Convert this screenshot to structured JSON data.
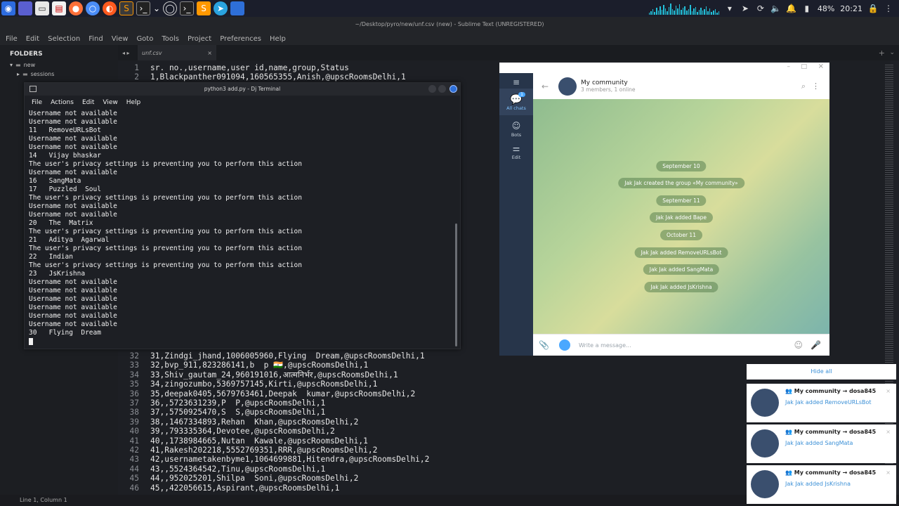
{
  "taskbar": {
    "apps": [
      "start-icon",
      "workspace-icon",
      "files-icon",
      "document-icon",
      "firefox-icon",
      "chromium-icon",
      "browser-icon",
      "sublime-icon",
      "terminal-icon",
      "app-launcher-chevron-icon",
      "terminal2-icon",
      "sublime2-icon",
      "telegram-icon",
      "folder-icon"
    ],
    "battery": "48%",
    "clock": "20:21"
  },
  "sublime": {
    "title": "~/Desktop/pyro/new/unf.csv (new) - Sublime Text (UNREGISTERED)",
    "menu": [
      "File",
      "Edit",
      "Selection",
      "Find",
      "View",
      "Goto",
      "Tools",
      "Project",
      "Preferences",
      "Help"
    ],
    "folders_title": "FOLDERS",
    "tree": [
      "new",
      "sessions"
    ],
    "tab": "unf.csv",
    "status": "Line 1, Column 1",
    "lines_top": [
      {
        "n": "1",
        "t": "sr. no.,username,user id,name,group,Status"
      },
      {
        "n": "2",
        "t": "1,Blackpanther091094,160565355,Anish,@upscRoomsDelhi,1"
      }
    ],
    "lines_bottom": [
      {
        "n": "32",
        "t": "31,Zindgi_jhand,1006005960,Flying  Dream,@upscRoomsDelhi,1"
      },
      {
        "n": "33",
        "t": "32,bvp_911,823286141,b  p 🇮🇳,@upscRoomsDelhi,1"
      },
      {
        "n": "34",
        "t": "33,Shiv_gautam_24,960191016,आत्मनिर्भर,@upscRoomsDelhi,1"
      },
      {
        "n": "35",
        "t": "34,zingozumbo,5369757145,Kirti,@upscRoomsDelhi,1"
      },
      {
        "n": "36",
        "t": "35,deepak0405,5679763461,Deepak  kumar,@upscRoomsDelhi,2"
      },
      {
        "n": "37",
        "t": "36,,5723631239,P  P,@upscRoomsDelhi,1"
      },
      {
        "n": "38",
        "t": "37,,5750925470,S  S,@upscRoomsDelhi,1"
      },
      {
        "n": "39",
        "t": "38,,1467334893,Rehan  Khan,@upscRoomsDelhi,2"
      },
      {
        "n": "40",
        "t": "39,,793335364,Devotee,@upscRoomsDelhi,2"
      },
      {
        "n": "41",
        "t": "40,,1738984665,Nutan  Kawale,@upscRoomsDelhi,1"
      },
      {
        "n": "42",
        "t": "41,Rakesh202218,5552769351,RRR,@upscRoomsDelhi,2"
      },
      {
        "n": "43",
        "t": "42,usernametakenbyme1,1064699881,Hitendra,@upscRoomsDelhi,2"
      },
      {
        "n": "44",
        "t": "43,,5524364542,Tinu,@upscRoomsDelhi,1"
      },
      {
        "n": "45",
        "t": "44,,952025201,Shilpa  Soni,@upscRoomsDelhi,2"
      },
      {
        "n": "46",
        "t": "45,,422056615,Aspirant,@upscRoomsDelhi,1"
      }
    ]
  },
  "terminal": {
    "title": "python3 add.py - Dj Terminal",
    "menu": [
      "File",
      "Actions",
      "Edit",
      "View",
      "Help"
    ],
    "lines": [
      "Username not available",
      "Username not available",
      "11   RemoveURLsBot",
      "Username not available",
      "Username not available",
      "14   Vijay bhaskar",
      "The user's privacy settings is preventing you to perform this action",
      "Username not available",
      "16   SangMata",
      "17   Puzzled  Soul",
      "The user's privacy settings is preventing you to perform this action",
      "Username not available",
      "Username not available",
      "20   The  Matrix",
      "The user's privacy settings is preventing you to perform this action",
      "21   Aditya  Agarwal",
      "The user's privacy settings is preventing you to perform this action",
      "22   Indian",
      "The user's privacy settings is preventing you to perform this action",
      "23   JsKrishna",
      "Username not available",
      "Username not available",
      "Username not available",
      "Username not available",
      "Username not available",
      "Username not available",
      "30   Flying  Dream"
    ]
  },
  "telegram": {
    "nav": [
      {
        "label": "All chats",
        "badge": "1"
      },
      {
        "label": "Bots"
      },
      {
        "label": "Edit"
      }
    ],
    "chat_name": "My community",
    "chat_sub": "3 members, 1 online",
    "service": [
      "September 10",
      "Jak Jak created the group «My community»",
      "September 11",
      "Jak Jak added Bape",
      "October 11",
      "Jak Jak added RemoveURLsBot",
      "Jak Jak added SangMata",
      "Jak Jak added JsKrishna"
    ],
    "input_placeholder": "Write a message..."
  },
  "notifications": {
    "hide_all": "Hide all",
    "items": [
      {
        "title": "My community → dosa845",
        "msg": "Jak Jak added RemoveURLsBot"
      },
      {
        "title": "My community → dosa845",
        "msg": "Jak Jak added SangMata"
      },
      {
        "title": "My community → dosa845",
        "msg": "Jak Jak added JsKrishna"
      }
    ]
  }
}
